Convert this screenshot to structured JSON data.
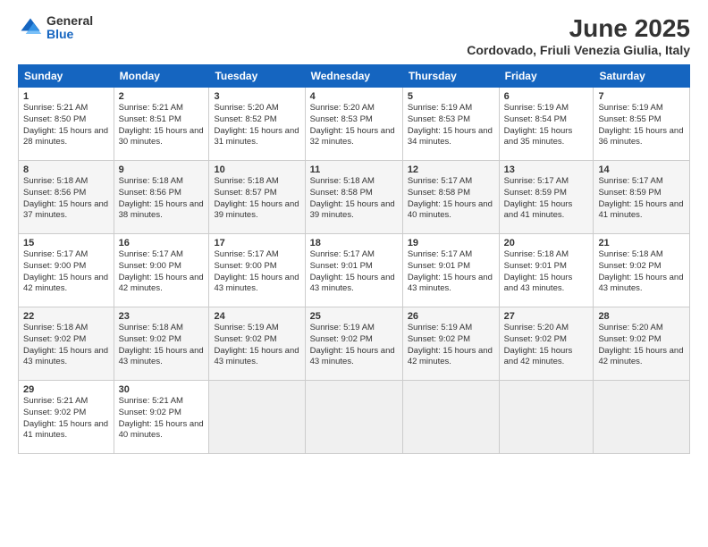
{
  "header": {
    "logo": {
      "general": "General",
      "blue": "Blue"
    },
    "title": "June 2025",
    "location": "Cordovado, Friuli Venezia Giulia, Italy"
  },
  "calendar": {
    "headers": [
      "Sunday",
      "Monday",
      "Tuesday",
      "Wednesday",
      "Thursday",
      "Friday",
      "Saturday"
    ],
    "weeks": [
      [
        null,
        {
          "day": "2",
          "sunrise": "5:21 AM",
          "sunset": "8:51 PM",
          "daylight": "15 hours and 30 minutes."
        },
        {
          "day": "3",
          "sunrise": "5:20 AM",
          "sunset": "8:52 PM",
          "daylight": "15 hours and 31 minutes."
        },
        {
          "day": "4",
          "sunrise": "5:20 AM",
          "sunset": "8:53 PM",
          "daylight": "15 hours and 32 minutes."
        },
        {
          "day": "5",
          "sunrise": "5:19 AM",
          "sunset": "8:53 PM",
          "daylight": "15 hours and 34 minutes."
        },
        {
          "day": "6",
          "sunrise": "5:19 AM",
          "sunset": "8:54 PM",
          "daylight": "15 hours and 35 minutes."
        },
        {
          "day": "7",
          "sunrise": "5:19 AM",
          "sunset": "8:55 PM",
          "daylight": "15 hours and 36 minutes."
        }
      ],
      [
        {
          "day": "1",
          "sunrise": "5:21 AM",
          "sunset": "8:50 PM",
          "daylight": "15 hours and 28 minutes."
        },
        {
          "day": "9",
          "sunrise": "5:18 AM",
          "sunset": "8:56 PM",
          "daylight": "15 hours and 38 minutes."
        },
        {
          "day": "10",
          "sunrise": "5:18 AM",
          "sunset": "8:57 PM",
          "daylight": "15 hours and 39 minutes."
        },
        {
          "day": "11",
          "sunrise": "5:18 AM",
          "sunset": "8:58 PM",
          "daylight": "15 hours and 39 minutes."
        },
        {
          "day": "12",
          "sunrise": "5:17 AM",
          "sunset": "8:58 PM",
          "daylight": "15 hours and 40 minutes."
        },
        {
          "day": "13",
          "sunrise": "5:17 AM",
          "sunset": "8:59 PM",
          "daylight": "15 hours and 41 minutes."
        },
        {
          "day": "14",
          "sunrise": "5:17 AM",
          "sunset": "8:59 PM",
          "daylight": "15 hours and 41 minutes."
        }
      ],
      [
        {
          "day": "8",
          "sunrise": "5:18 AM",
          "sunset": "8:56 PM",
          "daylight": "15 hours and 37 minutes."
        },
        {
          "day": "16",
          "sunrise": "5:17 AM",
          "sunset": "9:00 PM",
          "daylight": "15 hours and 42 minutes."
        },
        {
          "day": "17",
          "sunrise": "5:17 AM",
          "sunset": "9:00 PM",
          "daylight": "15 hours and 43 minutes."
        },
        {
          "day": "18",
          "sunrise": "5:17 AM",
          "sunset": "9:01 PM",
          "daylight": "15 hours and 43 minutes."
        },
        {
          "day": "19",
          "sunrise": "5:17 AM",
          "sunset": "9:01 PM",
          "daylight": "15 hours and 43 minutes."
        },
        {
          "day": "20",
          "sunrise": "5:18 AM",
          "sunset": "9:01 PM",
          "daylight": "15 hours and 43 minutes."
        },
        {
          "day": "21",
          "sunrise": "5:18 AM",
          "sunset": "9:02 PM",
          "daylight": "15 hours and 43 minutes."
        }
      ],
      [
        {
          "day": "15",
          "sunrise": "5:17 AM",
          "sunset": "9:00 PM",
          "daylight": "15 hours and 42 minutes."
        },
        {
          "day": "23",
          "sunrise": "5:18 AM",
          "sunset": "9:02 PM",
          "daylight": "15 hours and 43 minutes."
        },
        {
          "day": "24",
          "sunrise": "5:19 AM",
          "sunset": "9:02 PM",
          "daylight": "15 hours and 43 minutes."
        },
        {
          "day": "25",
          "sunrise": "5:19 AM",
          "sunset": "9:02 PM",
          "daylight": "15 hours and 43 minutes."
        },
        {
          "day": "26",
          "sunrise": "5:19 AM",
          "sunset": "9:02 PM",
          "daylight": "15 hours and 42 minutes."
        },
        {
          "day": "27",
          "sunrise": "5:20 AM",
          "sunset": "9:02 PM",
          "daylight": "15 hours and 42 minutes."
        },
        {
          "day": "28",
          "sunrise": "5:20 AM",
          "sunset": "9:02 PM",
          "daylight": "15 hours and 42 minutes."
        }
      ],
      [
        {
          "day": "22",
          "sunrise": "5:18 AM",
          "sunset": "9:02 PM",
          "daylight": "15 hours and 43 minutes."
        },
        {
          "day": "30",
          "sunrise": "5:21 AM",
          "sunset": "9:02 PM",
          "daylight": "15 hours and 40 minutes."
        },
        null,
        null,
        null,
        null,
        null
      ],
      [
        {
          "day": "29",
          "sunrise": "5:21 AM",
          "sunset": "9:02 PM",
          "daylight": "15 hours and 41 minutes."
        },
        null,
        null,
        null,
        null,
        null,
        null
      ]
    ]
  }
}
